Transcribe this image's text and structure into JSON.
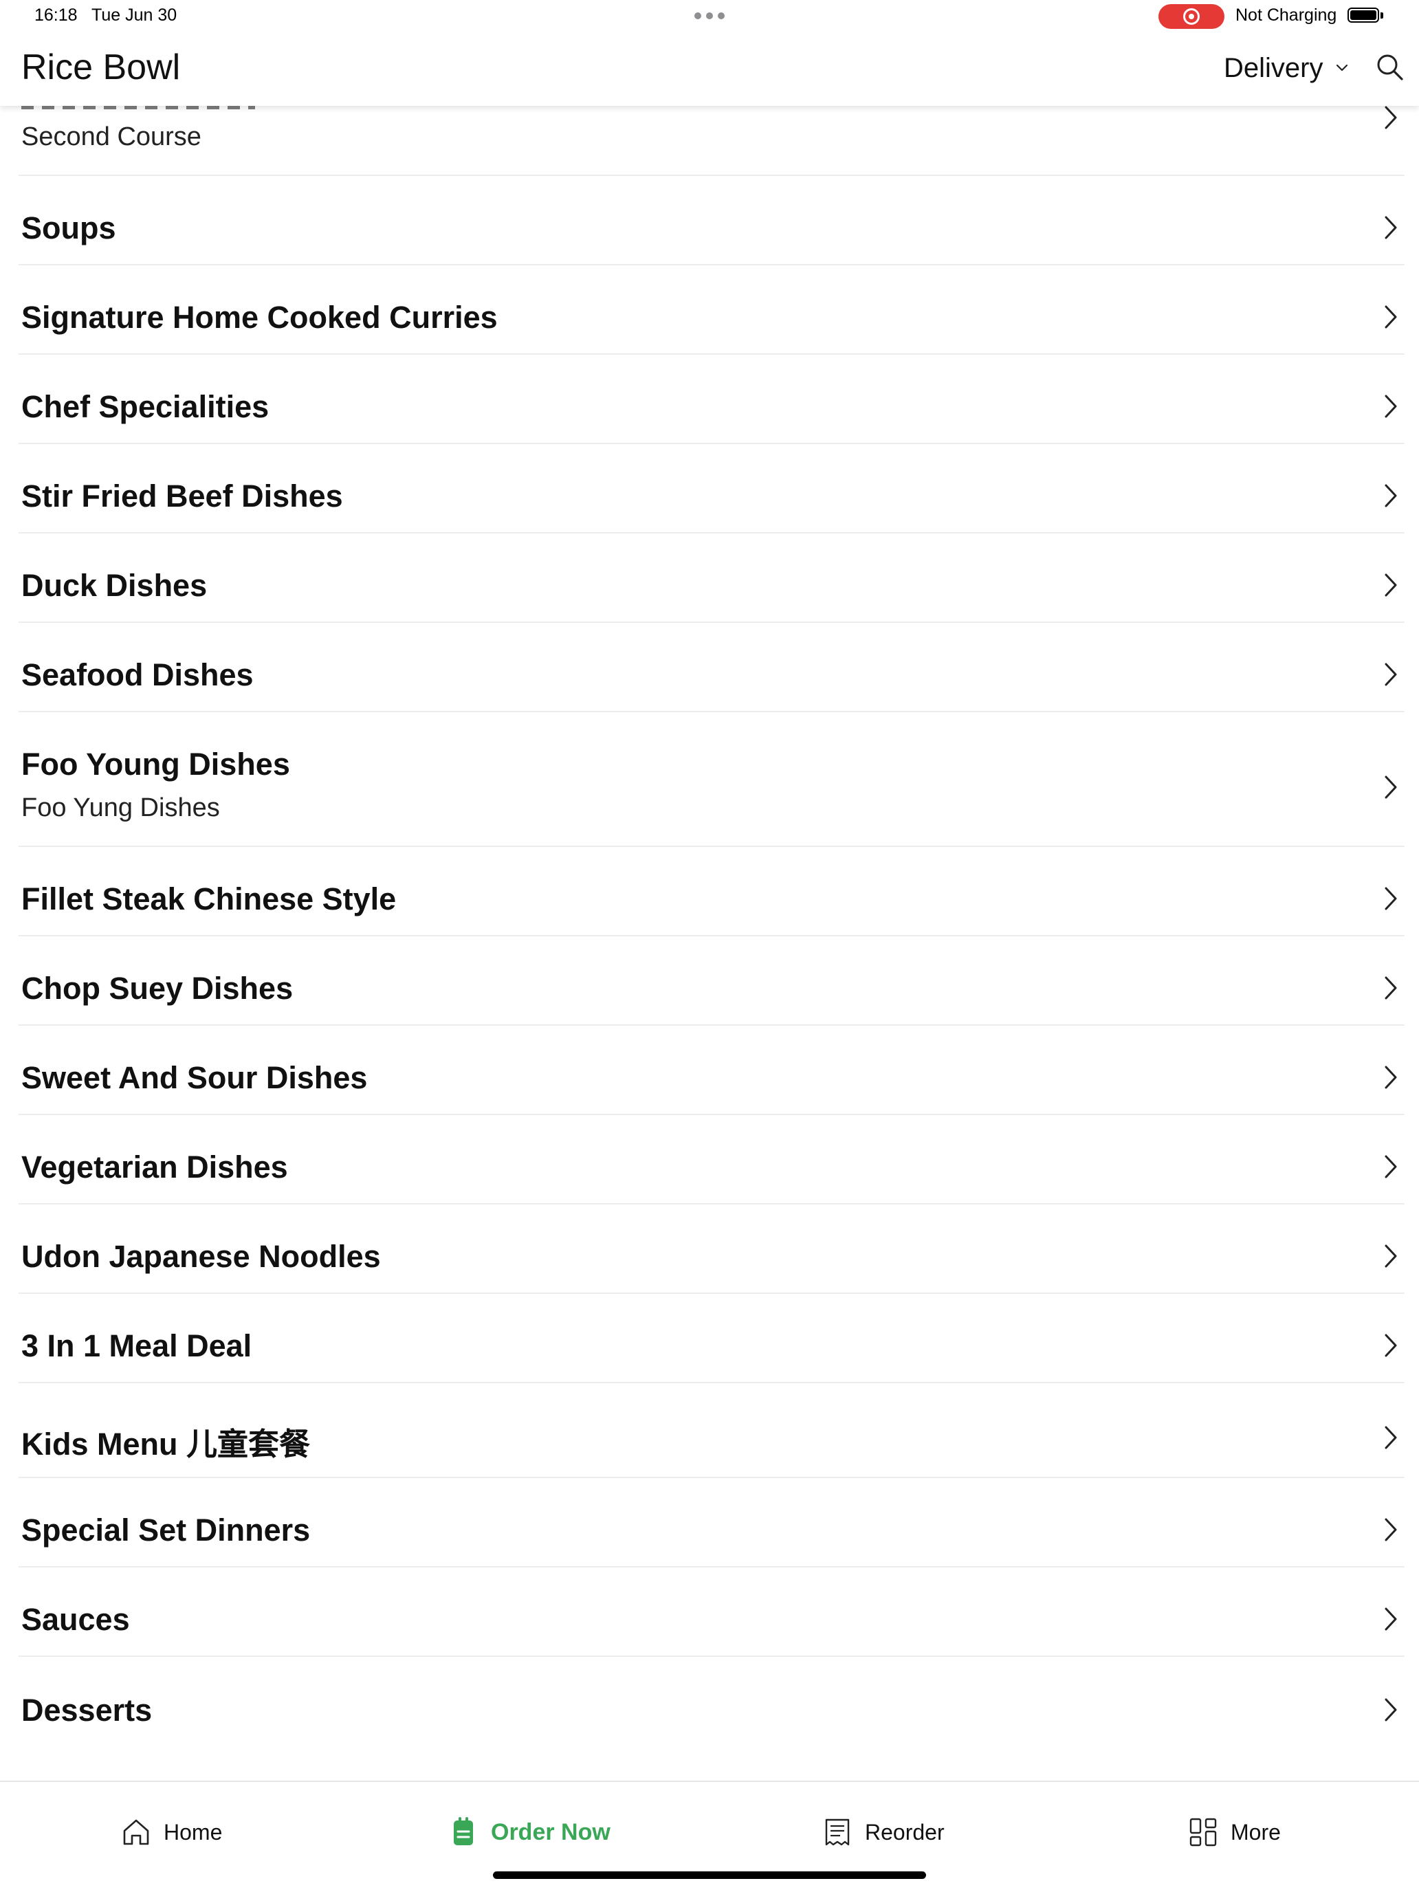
{
  "status_bar": {
    "time": "16:18",
    "date": "Tue Jun 30",
    "charging": "Not Charging",
    "record_color": "#e53935"
  },
  "header": {
    "title": "Rice Bowl",
    "delivery_label": "Delivery",
    "chevron_icon": "chevron-down-icon",
    "search_icon": "search-icon"
  },
  "menu": {
    "partial_item": {
      "subtitle": "Second Course"
    },
    "categories": [
      {
        "title": "Soups"
      },
      {
        "title": "Signature Home Cooked Curries"
      },
      {
        "title": "Chef Specialities"
      },
      {
        "title": "Stir Fried Beef Dishes"
      },
      {
        "title": "Duck Dishes"
      },
      {
        "title": "Seafood Dishes"
      },
      {
        "title": "Foo Young Dishes",
        "subtitle": "Foo Yung Dishes"
      },
      {
        "title": "Fillet Steak Chinese Style"
      },
      {
        "title": "Chop Suey Dishes"
      },
      {
        "title": "Sweet And Sour Dishes"
      },
      {
        "title": "Vegetarian Dishes"
      },
      {
        "title": "Udon Japanese Noodles"
      },
      {
        "title": "3 In 1 Meal Deal"
      },
      {
        "title": "Kids Menu 儿童套餐"
      },
      {
        "title": "Special Set Dinners"
      },
      {
        "title": "Sauces"
      },
      {
        "title": "Desserts"
      }
    ]
  },
  "bottom_nav": {
    "accent_color": "#3aa757",
    "items": [
      {
        "label": "Home",
        "icon": "home-icon",
        "active": false
      },
      {
        "label": "Order Now",
        "icon": "order-note-icon",
        "active": true
      },
      {
        "label": "Reorder",
        "icon": "receipt-icon",
        "active": false
      },
      {
        "label": "More",
        "icon": "grid-icon",
        "active": false
      }
    ]
  }
}
